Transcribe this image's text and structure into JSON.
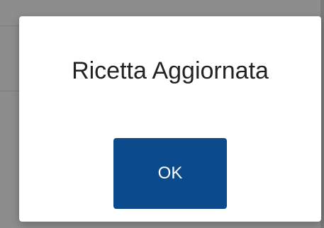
{
  "dialog": {
    "title": "Ricetta Aggiornata",
    "ok_label": "OK"
  },
  "colors": {
    "backdrop": "#8d8d8d",
    "dialog_background": "#ffffff",
    "button_background": "#0b4a8b",
    "button_text": "#ffffff",
    "title_text": "#222222"
  }
}
